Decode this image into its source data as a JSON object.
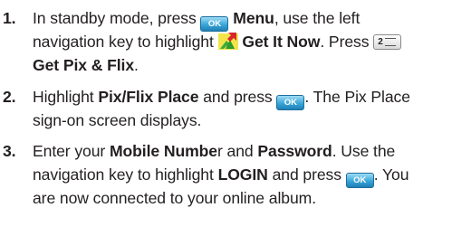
{
  "steps": [
    {
      "number": "1.",
      "lines": {
        "l1": {
          "t1": "In standby mode, press ",
          "b1": "Menu",
          "t2": ", use the left"
        },
        "l2": {
          "t1": "navigation key to highlight ",
          "b1": "Get It Now",
          "t2": ". Press "
        },
        "l3": {
          "b1": "Get Pix & Flix",
          "t2": "."
        }
      }
    },
    {
      "number": "2.",
      "lines": {
        "l1": {
          "t1": "Highlight ",
          "b1": "Pix/Flix Place",
          "t2": " and press ",
          "t3": ". The Pix Place"
        },
        "l2": {
          "t1": "sign-on screen displays."
        }
      }
    },
    {
      "number": "3.",
      "lines": {
        "l1": {
          "t1": "Enter your ",
          "b1": "Mobile Numbe",
          "t2": "r and ",
          "b2": "Password",
          "t3": ". Use the"
        },
        "l2": {
          "t1": "navigation key to highlight ",
          "b1": "LOGIN",
          "t2": " and press ",
          "t3": ". You"
        },
        "l3": {
          "t1": "are now connected to your online album."
        }
      }
    }
  ],
  "keys": {
    "ok_label": "OK",
    "two_digit": "2"
  },
  "icons": {
    "ok_key": "ok-key-icon",
    "get_it_now": "get-it-now-icon",
    "key_2": "key-2-abc-icon"
  },
  "colors": {
    "text": "#231f20",
    "ok_key": "#3aa6d8",
    "icon_green": "#3cab3a",
    "icon_red": "#d9262b"
  }
}
